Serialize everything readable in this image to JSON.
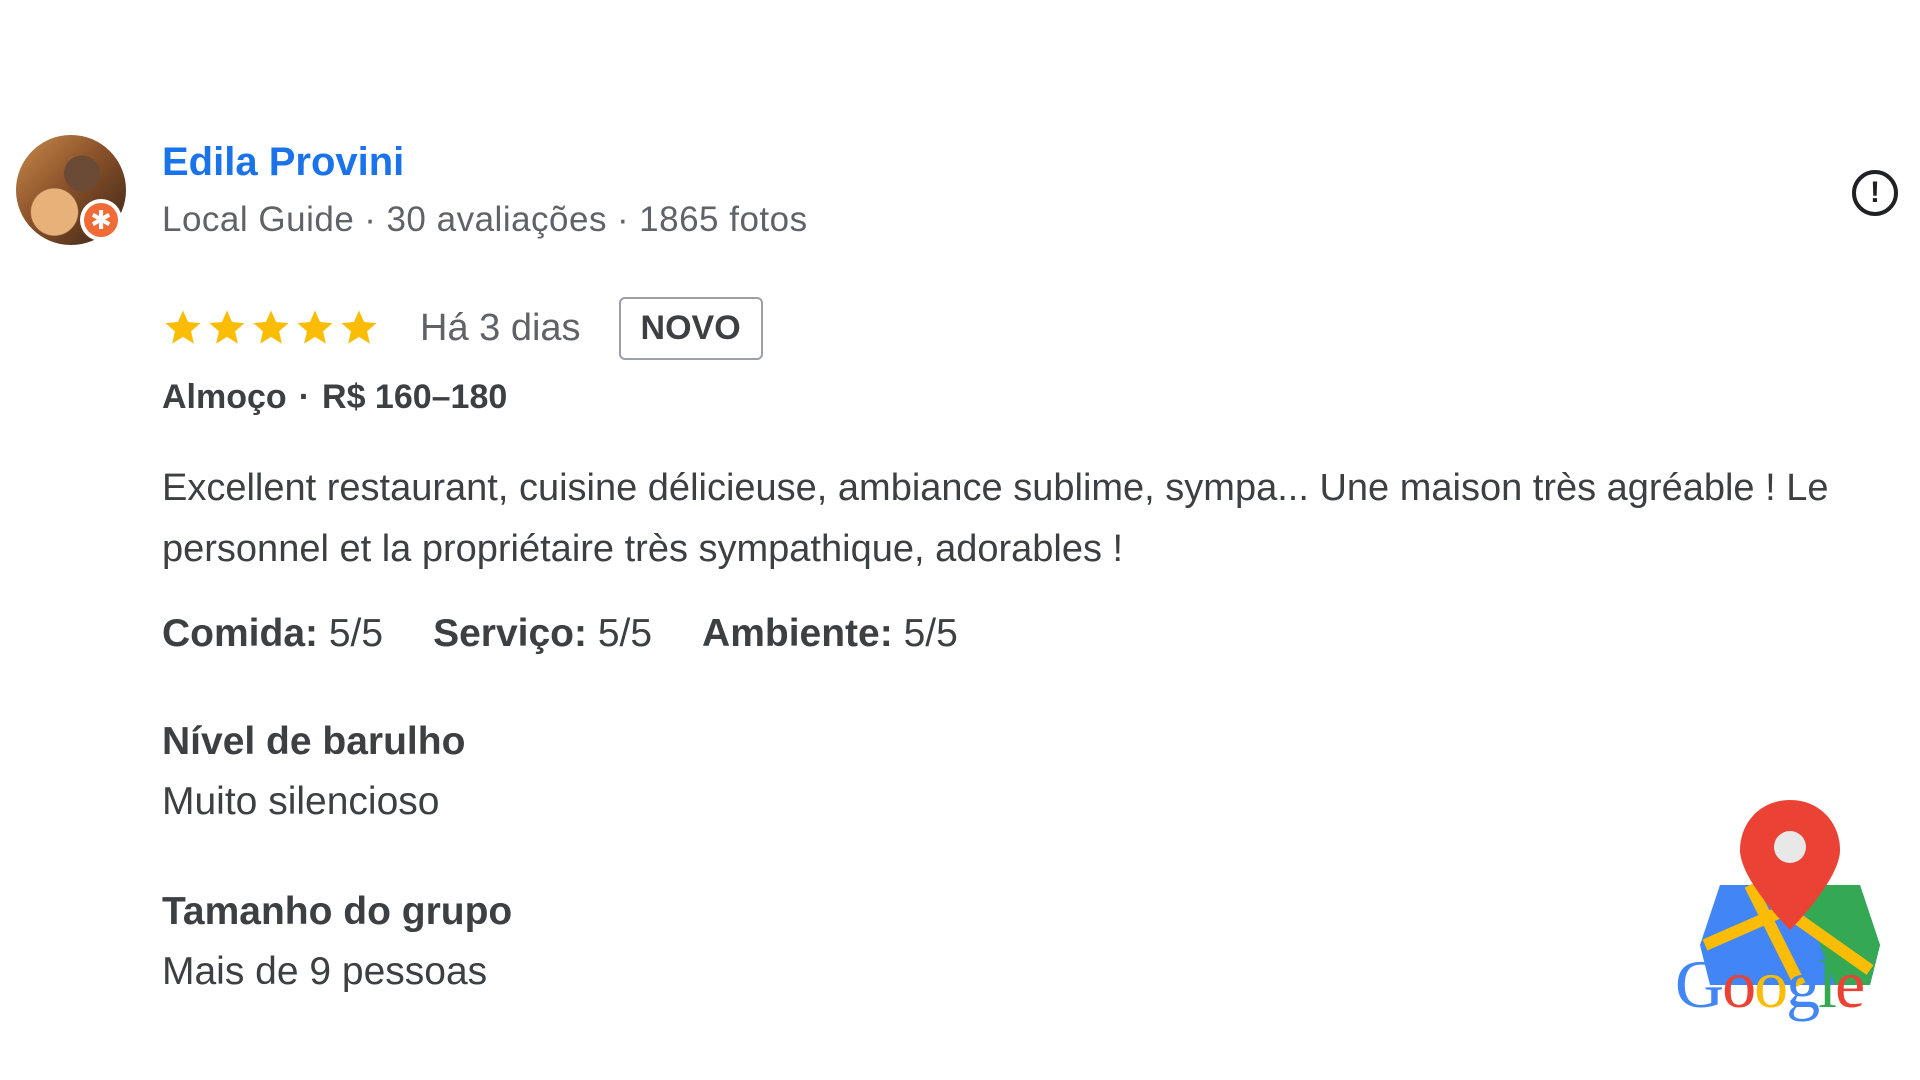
{
  "reviewer": {
    "name": "Edila Provini",
    "role": "Local Guide",
    "reviews_count": "30 avaliações",
    "photos_count": "1865 fotos",
    "separator": "·"
  },
  "report_icon": "alert-circle-icon",
  "rating": {
    "stars": 5,
    "max_stars": 5,
    "star_color": "#fbbc04",
    "time_ago": "Há 3 dias",
    "badge": "NOVO"
  },
  "meal": {
    "type": "Almoço",
    "price": "R$ 160–180",
    "separator": "·"
  },
  "review_text": "Excellent restaurant, cuisine délicieuse, ambiance sublime, sympa... Une maison très agréable ! Le personnel et la propriétaire très sympathique, adorables !",
  "scores": [
    {
      "label": "Comida:",
      "value": "5/5"
    },
    {
      "label": "Serviço:",
      "value": "5/5"
    },
    {
      "label": "Ambiente:",
      "value": "5/5"
    }
  ],
  "noise": {
    "title": "Nível de barulho",
    "value": "Muito silencioso"
  },
  "group": {
    "title": "Tamanho do grupo",
    "value": "Mais de 9 pessoas"
  },
  "logo": {
    "word": [
      "G",
      "o",
      "o",
      "g",
      "l",
      "e"
    ],
    "colors": [
      "#4285f4",
      "#ea4335",
      "#fbbc05",
      "#4285f4",
      "#34a853",
      "#ea4335"
    ],
    "icon": "google-maps-icon"
  },
  "colors": {
    "name": "#1a73e8",
    "badge_orange": "#f06b35"
  }
}
